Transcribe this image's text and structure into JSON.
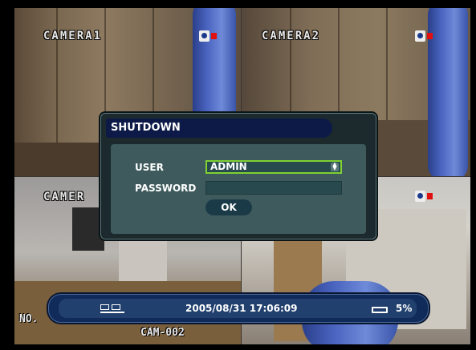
{
  "cameras": [
    {
      "label": "CAMERA1"
    },
    {
      "label": "CAMERA2"
    },
    {
      "label": "CAMER"
    }
  ],
  "dialog": {
    "title": "SHUTDOWN",
    "user_label": "USER",
    "user_value": "ADMIN",
    "password_label": "PASSWORD",
    "password_value": "",
    "ok_label": "OK"
  },
  "statusbar": {
    "datetime": "2005/08/31 17:06:09",
    "disk_usage": "5%"
  },
  "overlay": {
    "bottom_left": "NO.",
    "bottom_cam": "CAM-002"
  },
  "colors": {
    "accent": "#7ed232",
    "record_red": "#e01010",
    "statusbar_blue": "#102a5a"
  }
}
